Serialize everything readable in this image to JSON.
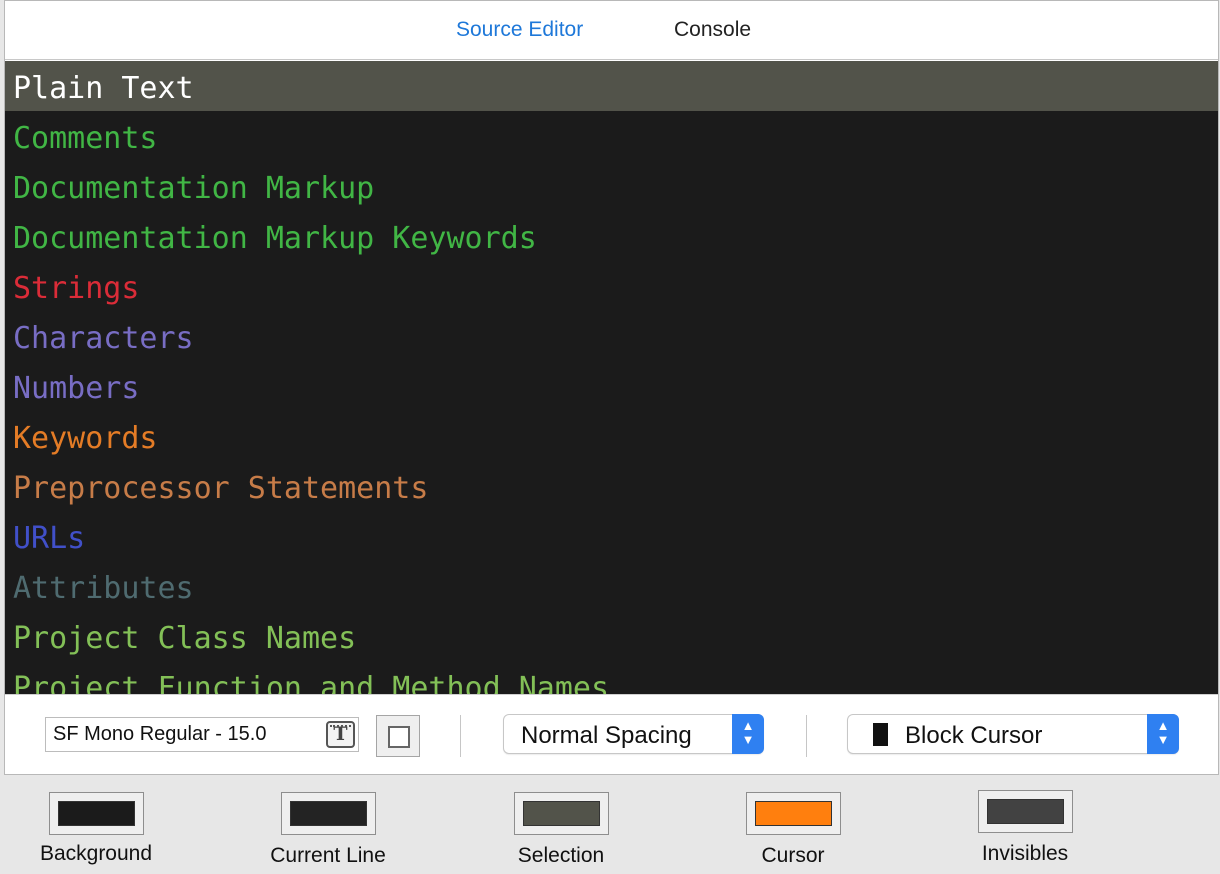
{
  "tabs": [
    {
      "label": "Source Editor",
      "active": true
    },
    {
      "label": "Console",
      "active": false
    }
  ],
  "syntax_items": [
    {
      "label": "Plain Text",
      "color": "#ffffff",
      "selected": true
    },
    {
      "label": "Comments",
      "color": "#41b645"
    },
    {
      "label": "Documentation Markup",
      "color": "#41b645"
    },
    {
      "label": "Documentation Markup Keywords",
      "color": "#41b645"
    },
    {
      "label": "Strings",
      "color": "#db2c38"
    },
    {
      "label": "Characters",
      "color": "#786dc4"
    },
    {
      "label": "Numbers",
      "color": "#786dc4"
    },
    {
      "label": "Keywords",
      "color": "#e47c26"
    },
    {
      "label": "Preprocessor Statements",
      "color": "#c77c48"
    },
    {
      "label": "URLs",
      "color": "#4150c9"
    },
    {
      "label": "Attributes",
      "color": "#4f6b70"
    },
    {
      "label": "Project Class Names",
      "color": "#83c057"
    },
    {
      "label": "Project Function and Method Names",
      "color": "#83c057"
    }
  ],
  "font": {
    "value": "SF Mono Regular - 15.0",
    "picker_icon": "font-picker-icon"
  },
  "spacing": {
    "selected": "Normal Spacing"
  },
  "cursor": {
    "selected": "Block Cursor"
  },
  "swatches": [
    {
      "key": "background",
      "label": "Background",
      "color": "#1b1b1b"
    },
    {
      "key": "current-line",
      "label": "Current Line",
      "color": "#232323"
    },
    {
      "key": "selection",
      "label": "Selection",
      "color": "#52534a"
    },
    {
      "key": "cursor",
      "label": "Cursor",
      "color": "#ff7f0e"
    },
    {
      "key": "invisibles",
      "label": "Invisibles",
      "color": "#424242"
    }
  ]
}
